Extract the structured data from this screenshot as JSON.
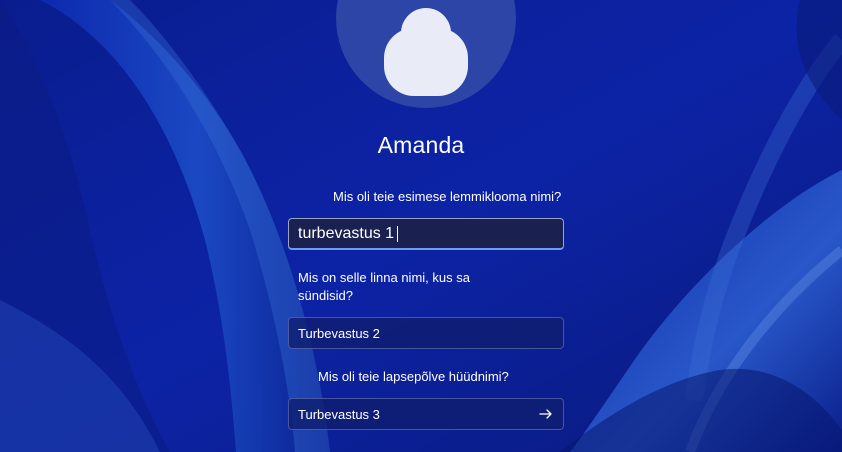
{
  "user": {
    "name": "Amanda"
  },
  "questions": [
    {
      "label": "Mis oli teie esimese lemmiklooma nimi?",
      "answer": "turbevastus 1"
    },
    {
      "label": "Mis on selle linna nimi, kus sa sündisid?",
      "answer": "Turbevastus 2"
    },
    {
      "label": "Mis oli teie lapsepõlve hüüdnimi?",
      "answer": "Turbevastus 3"
    }
  ],
  "icons": {
    "avatar": "user-avatar-icon",
    "submit": "arrow-right-icon"
  },
  "colors": {
    "background": "#0c1f9a",
    "focus_accent": "#6f9cf3",
    "text": "#ffffff"
  }
}
